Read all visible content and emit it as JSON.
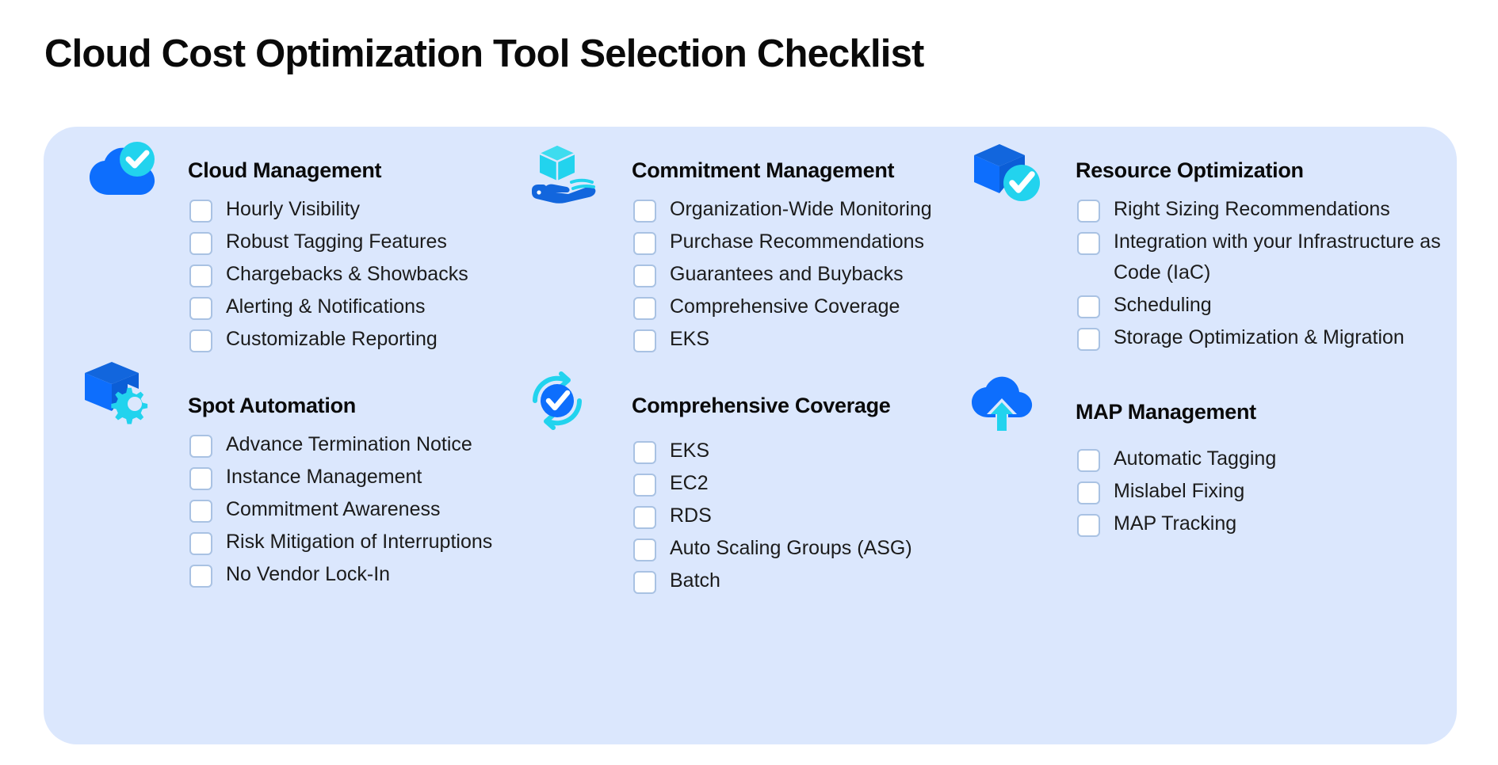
{
  "page": {
    "title": "Cloud Cost Optimization Tool Selection Checklist",
    "card_background": "#dbe7fd",
    "accent_blue": "#0d6efd",
    "accent_cyan": "#22d3ee"
  },
  "sections": [
    {
      "id": "cloud-management",
      "title": "Cloud Management",
      "icon": "cloud-check-icon",
      "items": [
        "Hourly Visibility",
        "Robust Tagging Features",
        "Chargebacks & Showbacks",
        "Alerting & Notifications",
        "Customizable Reporting"
      ]
    },
    {
      "id": "commitment-management",
      "title": "Commitment Management",
      "icon": "hand-cube-icon",
      "items": [
        "Organization-Wide Monitoring",
        "Purchase Recommendations",
        "Guarantees and Buybacks",
        "Comprehensive Coverage",
        "EKS"
      ]
    },
    {
      "id": "resource-optimization",
      "title": "Resource Optimization",
      "icon": "box-check-icon",
      "items": [
        "Right Sizing Recommendations",
        "Integration with your Infrastructure as Code (IaC)",
        "Scheduling",
        "Storage Optimization & Migration"
      ]
    },
    {
      "id": "spot-automation",
      "title": "Spot Automation",
      "icon": "box-gear-icon",
      "items": [
        "Advance Termination Notice",
        "Instance Management",
        "Commitment Awareness",
        "Risk Mitigation of Interruptions",
        "No Vendor Lock-In"
      ]
    },
    {
      "id": "comprehensive-coverage",
      "title": "Comprehensive Coverage",
      "icon": "refresh-check-icon",
      "items": [
        "EKS",
        "EC2",
        "RDS",
        "Auto Scaling Groups (ASG)",
        "Batch"
      ]
    },
    {
      "id": "map-management",
      "title": "MAP Management",
      "icon": "cloud-upload-icon",
      "items": [
        "Automatic Tagging",
        "Mislabel Fixing",
        "MAP Tracking"
      ]
    }
  ]
}
